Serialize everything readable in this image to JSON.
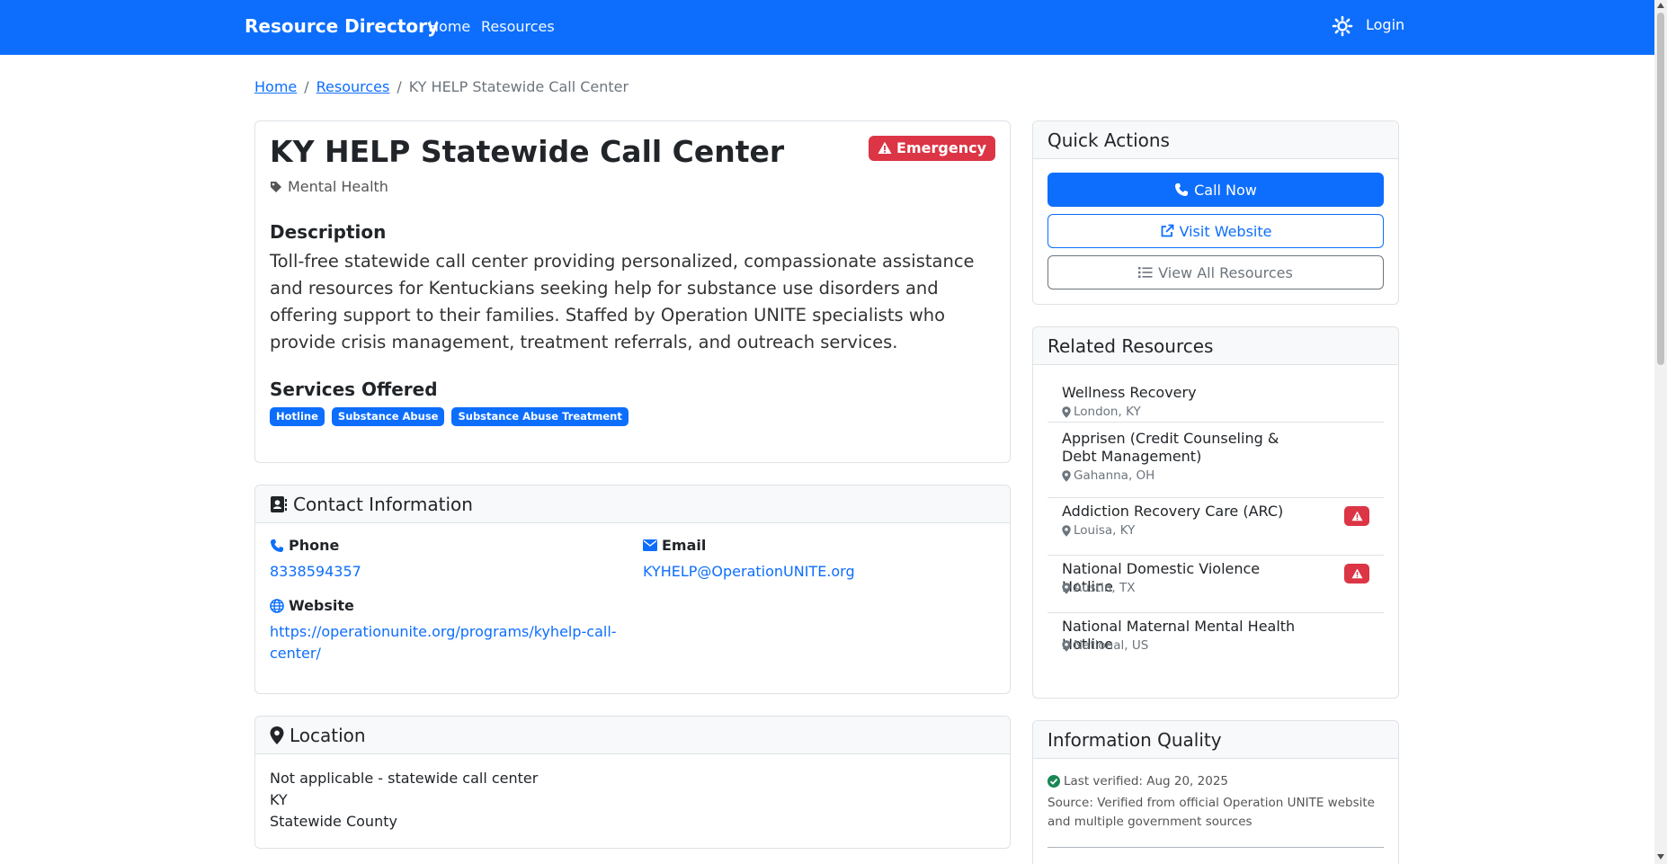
{
  "navbar": {
    "brand": "Resource Directory",
    "links": [
      "Home",
      "Resources"
    ],
    "login": "Login",
    "color": "#0d6efd"
  },
  "breadcrumb": {
    "home": "Home",
    "resources": "Resources",
    "current": "KY HELP Statewide Call Center"
  },
  "resource": {
    "title": "KY HELP Statewide Call Center",
    "badge": "Emergency",
    "category": "Mental Health",
    "description_heading": "Description",
    "description": "Toll-free statewide call center providing personalized, compassionate assistance and resources for Kentuckians seeking help for substance use disorders and offering support to their families. Staffed by Operation UNITE specialists who provide crisis management, treatment referrals, and outreach services.",
    "services_heading": "Services Offered",
    "services": [
      "Hotline",
      "Substance Abuse",
      "Substance Abuse Treatment"
    ]
  },
  "contact": {
    "heading": "Contact Information",
    "phone_label": "Phone",
    "phone": "8338594357",
    "email_label": "Email",
    "email": "KYHELP@OperationUNITE.org",
    "website_label": "Website",
    "website_line1": "https://operationunite.org/programs/kyhelp-call-",
    "website_line2": "center/"
  },
  "location": {
    "heading": "Location",
    "lines": [
      "Not applicable - statewide call center",
      "KY",
      "Statewide County"
    ]
  },
  "quick_actions": {
    "heading": "Quick Actions",
    "call": "Call Now",
    "visit": "Visit Website",
    "view_all": "View All Resources"
  },
  "related": {
    "heading": "Related Resources",
    "items": [
      {
        "name": "Wellness Recovery",
        "location": "London, KY",
        "emergency": false
      },
      {
        "name": "Apprisen (Credit Counseling & Debt Management)",
        "location": "Gahanna, OH",
        "emergency": false
      },
      {
        "name": "Addiction Recovery Care (ARC)",
        "location": "Louisa, KY",
        "emergency": true
      },
      {
        "name": "National Domestic Violence Hotline",
        "location": "Austin, TX",
        "emergency": true
      },
      {
        "name": "National Maternal Mental Health Hotline",
        "location": "National, US",
        "emergency": false
      }
    ]
  },
  "info_quality": {
    "heading": "Information Quality",
    "verified": "Last verified: Aug 20, 2025",
    "source": "Source: Verified from official Operation UNITE website and multiple government sources"
  },
  "colors": {
    "primary": "#0d6efd",
    "danger": "#dc3545",
    "secondary": "#6c757d",
    "success": "#198754"
  }
}
